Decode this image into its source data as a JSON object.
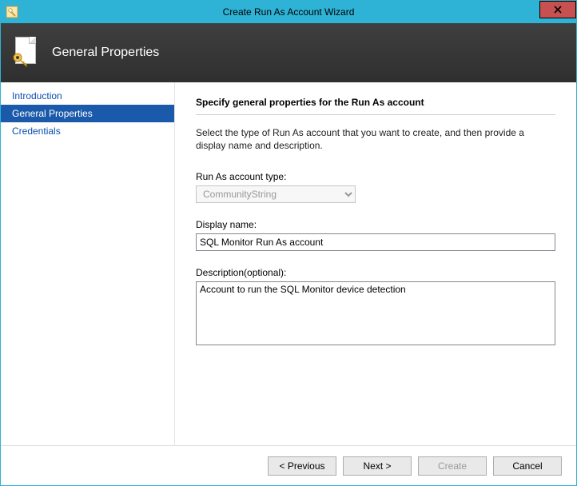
{
  "window": {
    "title": "Create Run As Account Wizard"
  },
  "header": {
    "title": "General Properties"
  },
  "sidebar": {
    "items": [
      {
        "label": "Introduction",
        "selected": false
      },
      {
        "label": "General Properties",
        "selected": true
      },
      {
        "label": "Credentials",
        "selected": false
      }
    ]
  },
  "content": {
    "heading": "Specify general properties for the Run As account",
    "description": "Select the type of Run As account that you want to create, and then provide a display name and description.",
    "account_type": {
      "label": "Run As account type:",
      "value": "CommunityString",
      "disabled": true
    },
    "display_name": {
      "label": "Display name:",
      "value": "SQL Monitor Run As account"
    },
    "description_field": {
      "label": "Description(optional):",
      "value": "Account to run the SQL Monitor device detection"
    }
  },
  "footer": {
    "previous": "< Previous",
    "next": "Next >",
    "create": "Create",
    "cancel": "Cancel",
    "create_disabled": true
  }
}
